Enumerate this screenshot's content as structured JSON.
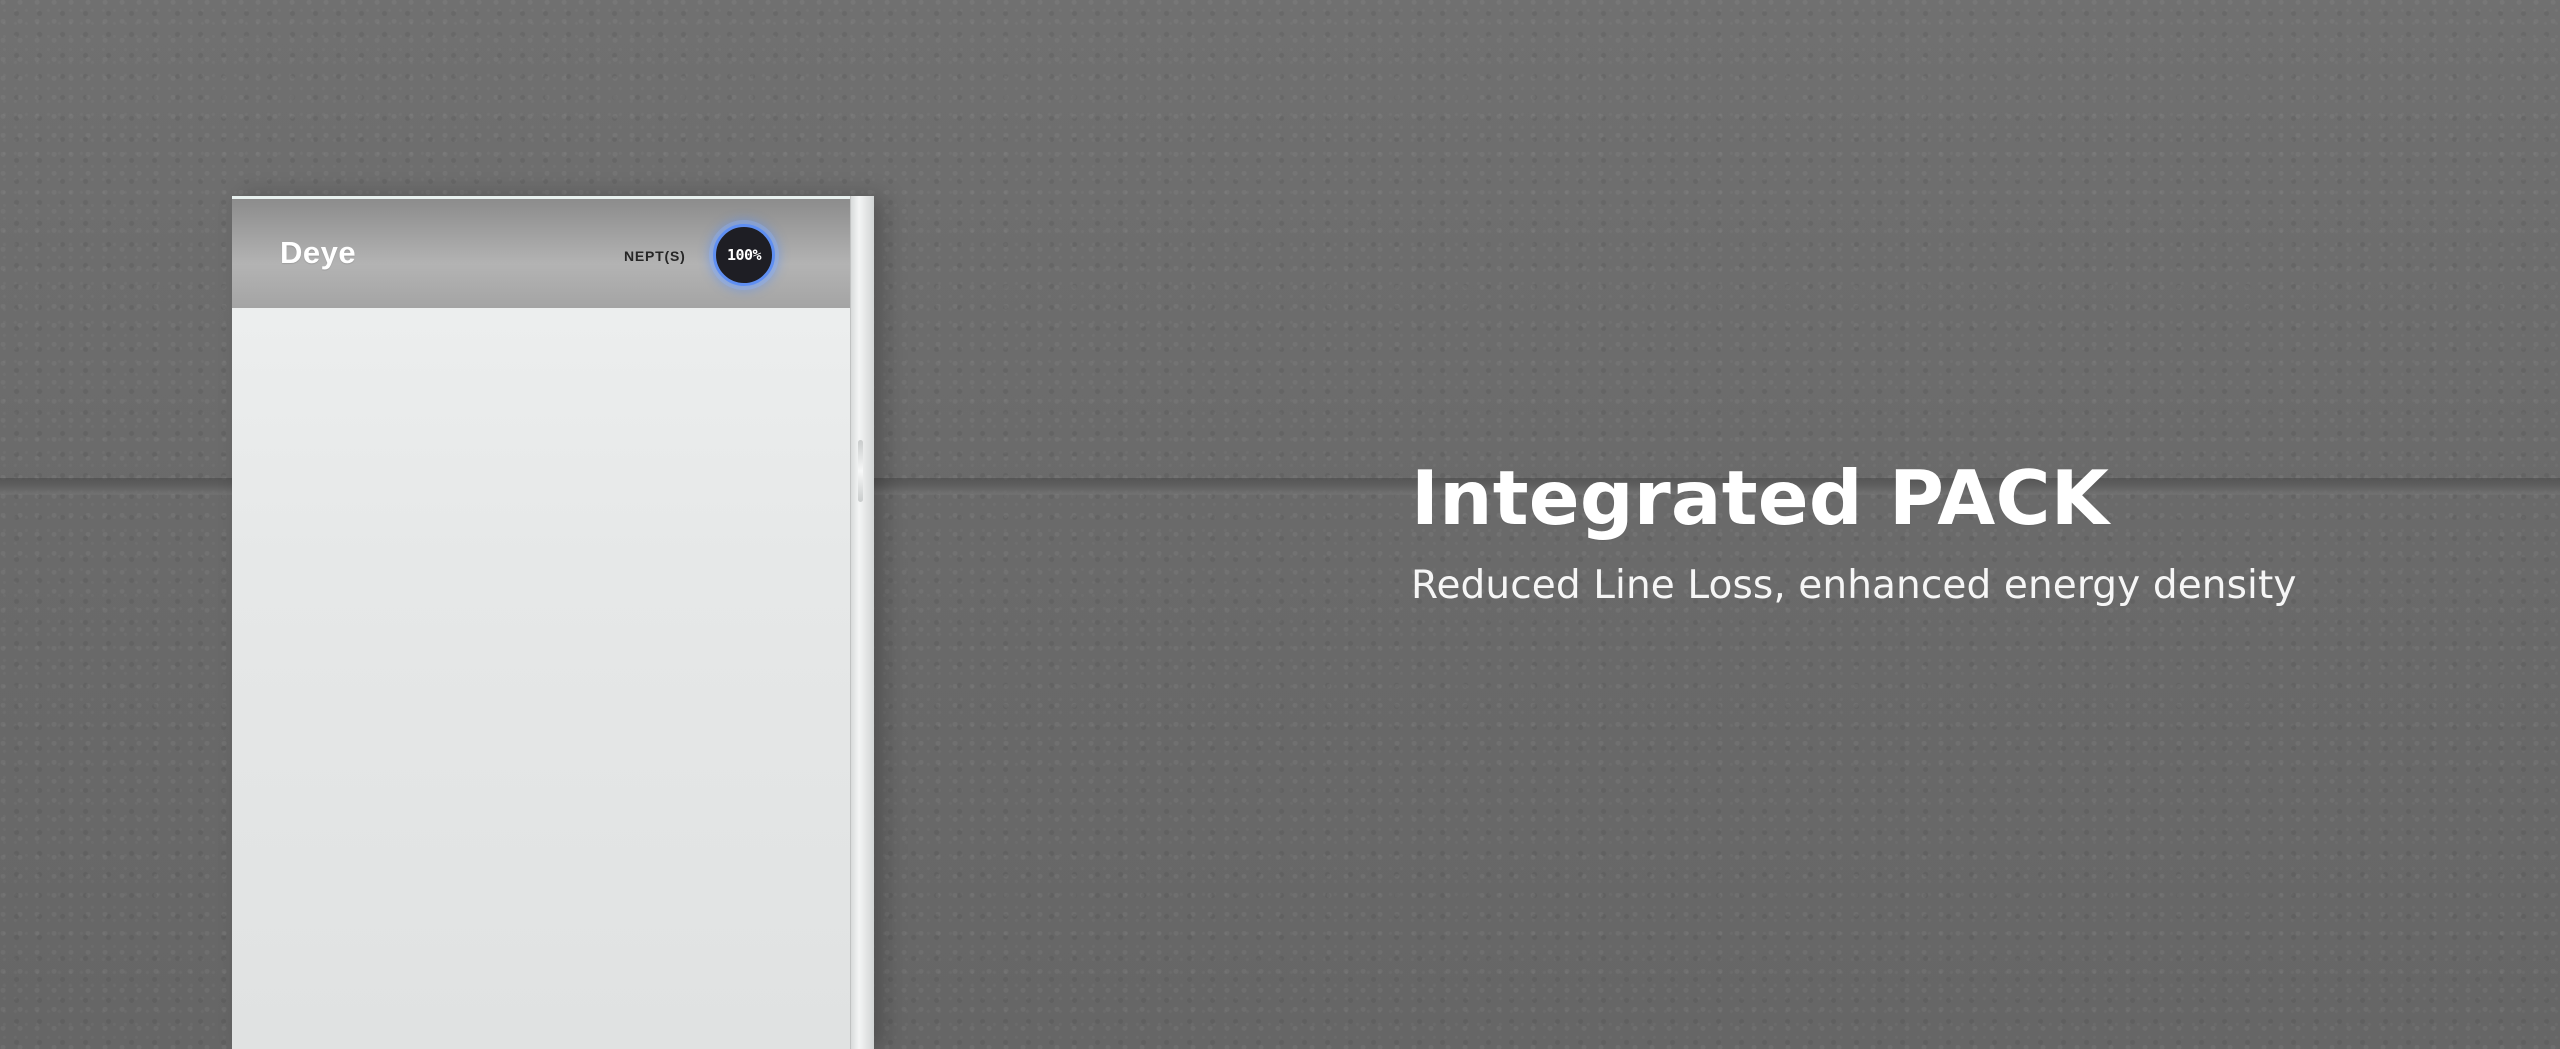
{
  "hero": {
    "title": "Integrated PACK",
    "subtitle": "Reduced Line Loss, enhanced energy density"
  },
  "product": {
    "brand": "Deye",
    "model": "NEPT(S)",
    "display_value": "100%"
  },
  "colors": {
    "wall": "#6b6b6b",
    "battery_body": "#e6e8e8",
    "battery_top": "#a6a6a6",
    "display_ring": "#5f8ff2",
    "text": "#ffffff"
  }
}
